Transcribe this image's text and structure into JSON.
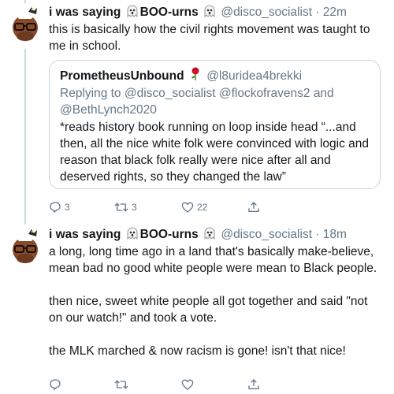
{
  "tweet1": {
    "display_name": "i was saying",
    "display_name_suffix": "BOO-urns",
    "handle": "@disco_socialist",
    "separator": "·",
    "time": "22m",
    "text": "this is basically how the civil rights movement was taught to me in school.",
    "quote": {
      "display_name": "PrometheusUnbound",
      "handle": "@l8uridea4brekki",
      "reply_prefix": "Replying to",
      "reply_to": "@disco_socialist @flockofravens2 and @BethLynch2020",
      "text": "*reads history book running on loop inside head “...and then, all the nice white folk were convinced with logic and reason that black folk really were nice after all and deserved rights, so they changed the law”"
    },
    "actions": {
      "replies": "3",
      "retweets": "3",
      "likes": "22"
    }
  },
  "tweet2": {
    "display_name": "i was saying",
    "display_name_suffix": "BOO-urns",
    "handle": "@disco_socialist",
    "separator": "·",
    "time": "18m",
    "paragraphs": [
      "a long, long time ago in a land that's basically make-believe, mean bad no good white people were mean to Black people.",
      "then nice, sweet white people all got together and said \"not on our watch!\" and took a vote.",
      "the MLK marched & now racism is gone! isn't that nice!"
    ]
  },
  "icons": [
    "ghost-emoji-icon",
    "rose-emoji-icon",
    "reply-icon",
    "retweet-icon",
    "like-icon",
    "share-icon"
  ],
  "colors": {
    "text": "#14171a",
    "secondary": "#657786",
    "border": "#ccd6dd"
  }
}
